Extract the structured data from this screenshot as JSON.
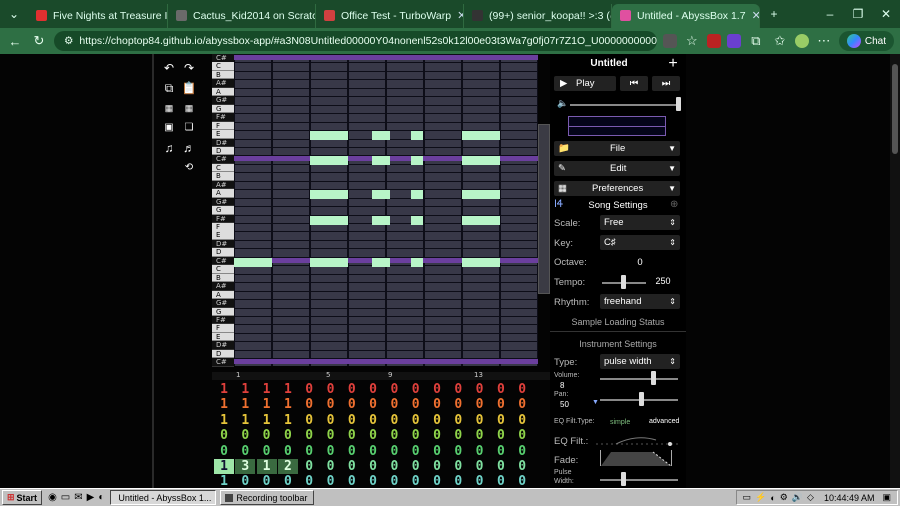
{
  "browser": {
    "tabs": [
      {
        "title": "Five Nights at Treasure Island: /",
        "color": "#e03030"
      },
      {
        "title": "Cactus_Kid2014 on Scratch",
        "color": "#6a6a6a"
      },
      {
        "title": "Office Test - TurboWarp",
        "color": "#d04040"
      },
      {
        "title": "(99+) senior_koopa!! >:3 (@Ko",
        "color": "#333333"
      },
      {
        "title": "Untitled - AbyssBox 1.7",
        "color": "#e050a0"
      }
    ],
    "url": "https://choptop84.github.io/abyssbox-app/#a3N08Untitled00000Y04nonenl52s0k12l00e03t3Wa7g0fj07r7Z1O_U0000000000000...",
    "chat_label": "Chat"
  },
  "keys": [
    "C#",
    "C",
    "B",
    "A#",
    "A",
    "G#",
    "G",
    "F#",
    "F",
    "E",
    "D#",
    "D",
    "C#",
    "C",
    "B",
    "A#",
    "A",
    "G#",
    "G",
    "F#",
    "F",
    "E",
    "D#",
    "D",
    "C#",
    "C",
    "B",
    "A#",
    "A",
    "G#",
    "G",
    "F#",
    "F",
    "E",
    "D#",
    "D",
    "C#"
  ],
  "track": {
    "bar_numbers": [
      "1",
      "5",
      "9",
      "13"
    ],
    "rows": [
      {
        "values": [
          "1",
          "1",
          "1",
          "1",
          "0",
          "0",
          "0",
          "0",
          "0",
          "0",
          "0",
          "0",
          "0",
          "0",
          "0"
        ],
        "color": "#e0403c"
      },
      {
        "values": [
          "1",
          "1",
          "1",
          "1",
          "0",
          "0",
          "0",
          "0",
          "0",
          "0",
          "0",
          "0",
          "0",
          "0",
          "0"
        ],
        "color": "#f07030"
      },
      {
        "values": [
          "1",
          "1",
          "1",
          "1",
          "0",
          "0",
          "0",
          "0",
          "0",
          "0",
          "0",
          "0",
          "0",
          "0",
          "0"
        ],
        "color": "#e6c43a"
      },
      {
        "values": [
          "0",
          "0",
          "0",
          "0",
          "0",
          "0",
          "0",
          "0",
          "0",
          "0",
          "0",
          "0",
          "0",
          "0",
          "0"
        ],
        "color": "#8fd44a"
      },
      {
        "values": [
          "0",
          "0",
          "0",
          "0",
          "0",
          "0",
          "0",
          "0",
          "0",
          "0",
          "0",
          "0",
          "0",
          "0",
          "0"
        ],
        "color": "#58d070"
      },
      {
        "values": [
          "1",
          "3",
          "1",
          "2",
          "0",
          "0",
          "0",
          "0",
          "0",
          "0",
          "0",
          "0",
          "0",
          "0",
          "0"
        ],
        "color": "#7fe0a0"
      },
      {
        "values": [
          "1",
          "0",
          "0",
          "0",
          "0",
          "0",
          "0",
          "0",
          "0",
          "0",
          "0",
          "0",
          "0",
          "0",
          "0"
        ],
        "color": "#6fd3c8"
      }
    ]
  },
  "panel": {
    "song_title": "Untitled",
    "play_label": "Play",
    "file_label": "File",
    "edit_label": "Edit",
    "preferences_label": "Preferences",
    "song_settings_title": "Song Settings",
    "scale_label": "Scale:",
    "scale_value": "Free",
    "key_label": "Key:",
    "key_value": "C♯",
    "octave_label": "Octave:",
    "octave_value": "0",
    "tempo_label": "Tempo:",
    "tempo_value": "250",
    "rhythm_label": "Rhythm:",
    "rhythm_value": "freehand",
    "sample_loading": "Sample Loading Status",
    "instrument_settings_title": "Instrument Settings",
    "type_label": "Type:",
    "type_value": "pulse width",
    "volume_label": "Volume:",
    "volume_value": "8",
    "pan_label": "Pan:",
    "pan_value": "50",
    "eq_filt_type_label": "EQ Filt.Type:",
    "eq_simple": "simple",
    "eq_advanced": "advanced",
    "eq_filt_label": "EQ Filt.:",
    "fade_label": "Fade:",
    "pulse_width_label": "Pulse Width:"
  },
  "taskbar": {
    "start_label": "Start",
    "windows": [
      "Untitled - AbyssBox 1...",
      "Recording toolbar"
    ],
    "clock": "10:44:49 AM"
  },
  "colors": {
    "note": "#b8f5c8",
    "octave_line": "#6b3f9e",
    "grid_cell": "#383848",
    "accent": "#6b3f9e"
  }
}
